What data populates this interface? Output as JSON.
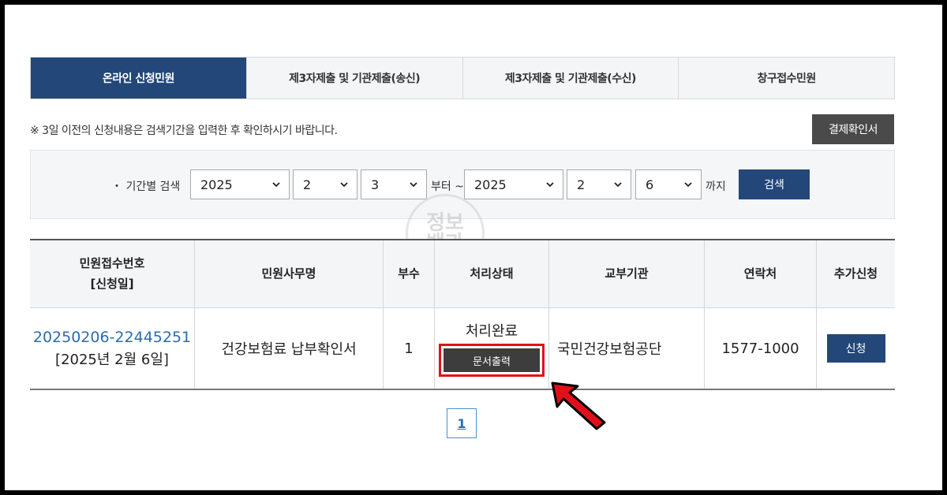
{
  "tabs": [
    {
      "label": "온라인 신청민원",
      "active": true
    },
    {
      "label": "제3자제출 및 기관제출(송신)",
      "active": false
    },
    {
      "label": "제3자제출 및 기관제출(수신)",
      "active": false
    },
    {
      "label": "창구접수민원",
      "active": false
    }
  ],
  "notice": "※ 3일 이전의 신청내용은 검색기간을 입력한 후 확인하시기 바랍니다.",
  "confirm_button": "결제확인서",
  "search": {
    "label": "・ 기간별 검색",
    "from_year": "2025",
    "from_month": "2",
    "from_day": "3",
    "from_suffix": "부터 ~",
    "to_year": "2025",
    "to_month": "2",
    "to_day": "6",
    "to_suffix": "까지",
    "button": "검색"
  },
  "watermark": {
    "line1": "정보",
    "line2": "백과"
  },
  "table": {
    "headers": {
      "receipt_no_line1": "민원접수번호",
      "receipt_no_line2": "[신청일]",
      "service_name": "민원사무명",
      "copies": "부수",
      "status": "처리상태",
      "issuer": "교부기관",
      "contact": "연락처",
      "additional": "추가신청"
    },
    "rows": [
      {
        "receipt_no": "20250206-22445251",
        "date": "[2025년 2월 6일]",
        "service_name": "건강보험료 납부확인서",
        "copies": "1",
        "status": "처리완료",
        "print_button": "문서출력",
        "issuer": "국민건강보험공단",
        "contact": "1577-1000",
        "apply_button": "신청"
      }
    ]
  },
  "pagination": {
    "current": "1"
  },
  "colors": {
    "primary": "#234779",
    "highlight": "#e0101a",
    "link": "#2a6cb0"
  }
}
